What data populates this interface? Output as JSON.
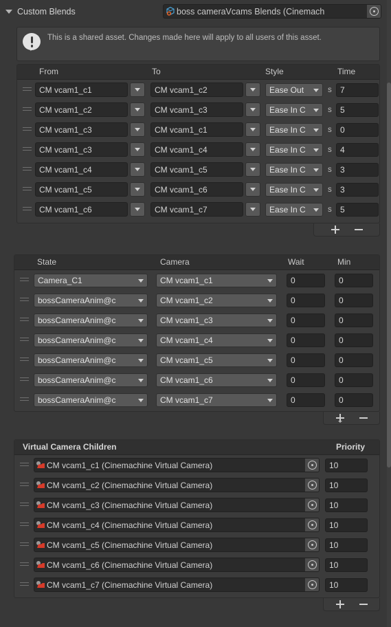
{
  "window": {
    "title": "Custom Blends",
    "foldout_expanded": true,
    "background_color": "#383838"
  },
  "asset_field": {
    "icon": "scriptable-object-icon",
    "value": "boss cameraVcams Blends (Cinemach",
    "picker_icon": "object-picker-icon"
  },
  "help_box": {
    "icon": "info-icon",
    "message": "This is a shared asset.  Changes made here will apply to all users of this asset."
  },
  "blends_list": {
    "columns": [
      "From",
      "To",
      "Style",
      "Time"
    ],
    "unit_label": "s",
    "rows": [
      {
        "from": "CM vcam1_c1",
        "to": "CM vcam1_c2",
        "style": "Ease Out",
        "time": "7"
      },
      {
        "from": "CM vcam1_c2",
        "to": "CM vcam1_c3",
        "style": "Ease In C",
        "time": "5"
      },
      {
        "from": "CM vcam1_c3",
        "to": "CM vcam1_c1",
        "style": "Ease In C",
        "time": "0"
      },
      {
        "from": "CM vcam1_c3",
        "to": "CM vcam1_c4",
        "style": "Ease In C",
        "time": "4"
      },
      {
        "from": "CM vcam1_c4",
        "to": "CM vcam1_c5",
        "style": "Ease In C",
        "time": "3"
      },
      {
        "from": "CM vcam1_c5",
        "to": "CM vcam1_c6",
        "style": "Ease In C",
        "time": "3"
      },
      {
        "from": "CM vcam1_c6",
        "to": "CM vcam1_c7",
        "style": "Ease In C",
        "time": "5"
      }
    ],
    "footer": {
      "add": "+",
      "remove": "−"
    }
  },
  "states_list": {
    "columns": [
      "State",
      "Camera",
      "Wait",
      "Min"
    ],
    "rows": [
      {
        "state": "Camera_C1",
        "camera": "CM vcam1_c1",
        "wait": "0",
        "min": "0"
      },
      {
        "state": "bossCameraAnim@c",
        "camera": "CM vcam1_c2",
        "wait": "0",
        "min": "0"
      },
      {
        "state": "bossCameraAnim@c",
        "camera": "CM vcam1_c3",
        "wait": "0",
        "min": "0"
      },
      {
        "state": "bossCameraAnim@c",
        "camera": "CM vcam1_c4",
        "wait": "0",
        "min": "0"
      },
      {
        "state": "bossCameraAnim@c",
        "camera": "CM vcam1_c5",
        "wait": "0",
        "min": "0"
      },
      {
        "state": "bossCameraAnim@c",
        "camera": "CM vcam1_c6",
        "wait": "0",
        "min": "0"
      },
      {
        "state": "bossCameraAnim@c",
        "camera": "CM vcam1_c7",
        "wait": "0",
        "min": "0"
      }
    ],
    "footer": {
      "add": "+",
      "remove": "−",
      "add_has_dropdown": true
    }
  },
  "children_list": {
    "title": "Virtual Camera Children",
    "priority_column": "Priority",
    "rows": [
      {
        "camera": "CM vcam1_c1 (Cinemachine Virtual Camera)",
        "priority": "10"
      },
      {
        "camera": "CM vcam1_c2 (Cinemachine Virtual Camera)",
        "priority": "10"
      },
      {
        "camera": "CM vcam1_c3 (Cinemachine Virtual Camera)",
        "priority": "10"
      },
      {
        "camera": "CM vcam1_c4 (Cinemachine Virtual Camera)",
        "priority": "10"
      },
      {
        "camera": "CM vcam1_c5 (Cinemachine Virtual Camera)",
        "priority": "10"
      },
      {
        "camera": "CM vcam1_c6 (Cinemachine Virtual Camera)",
        "priority": "10"
      },
      {
        "camera": "CM vcam1_c7 (Cinemachine Virtual Camera)",
        "priority": "10"
      }
    ],
    "footer": {
      "add": "+",
      "remove": "−"
    }
  },
  "colors": {
    "panel": "#383838",
    "list_bg": "#3b3b3b",
    "header_bg": "#303030",
    "field_bg": "#282828",
    "popup_bg": "#585858",
    "text": "#c9c9c9",
    "cinemachine_accent": "#d63b2a"
  }
}
